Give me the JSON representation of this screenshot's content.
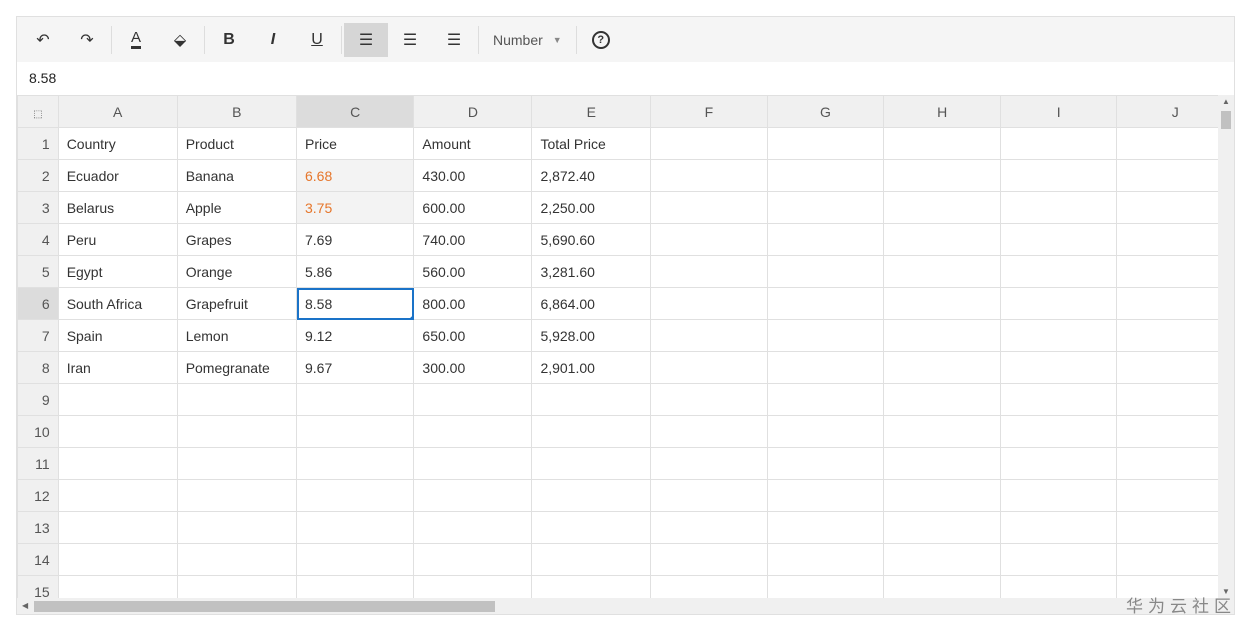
{
  "toolbar": {
    "number_format": "Number"
  },
  "formula_bar": {
    "value": "8.58"
  },
  "columns": [
    "A",
    "B",
    "C",
    "D",
    "E",
    "F",
    "G",
    "H",
    "I",
    "J"
  ],
  "rows": [
    [
      "Country",
      "Product",
      "Price",
      "Amount",
      "Total Price"
    ],
    [
      "Ecuador",
      "Banana",
      "6.68",
      "430.00",
      "2,872.40"
    ],
    [
      "Belarus",
      "Apple",
      "3.75",
      "600.00",
      "2,250.00"
    ],
    [
      "Peru",
      "Grapes",
      "7.69",
      "740.00",
      "5,690.60"
    ],
    [
      "Egypt",
      "Orange",
      "5.86",
      "560.00",
      "3,281.60"
    ],
    [
      "South Africa",
      "Grapefruit",
      "8.58",
      "800.00",
      "6,864.00"
    ],
    [
      "Spain",
      "Lemon",
      "9.12",
      "650.00",
      "5,928.00"
    ],
    [
      "Iran",
      "Pomegranate",
      "9.67",
      "300.00",
      "2,901.00"
    ]
  ],
  "row_numbers": [
    "1",
    "2",
    "3",
    "4",
    "5",
    "6",
    "7",
    "8",
    "9",
    "10",
    "11",
    "12",
    "13",
    "14",
    "15"
  ],
  "watermark": "华为云社区",
  "colors": {
    "accent": "#1a73c8",
    "highlight_text": "#e6762b"
  }
}
